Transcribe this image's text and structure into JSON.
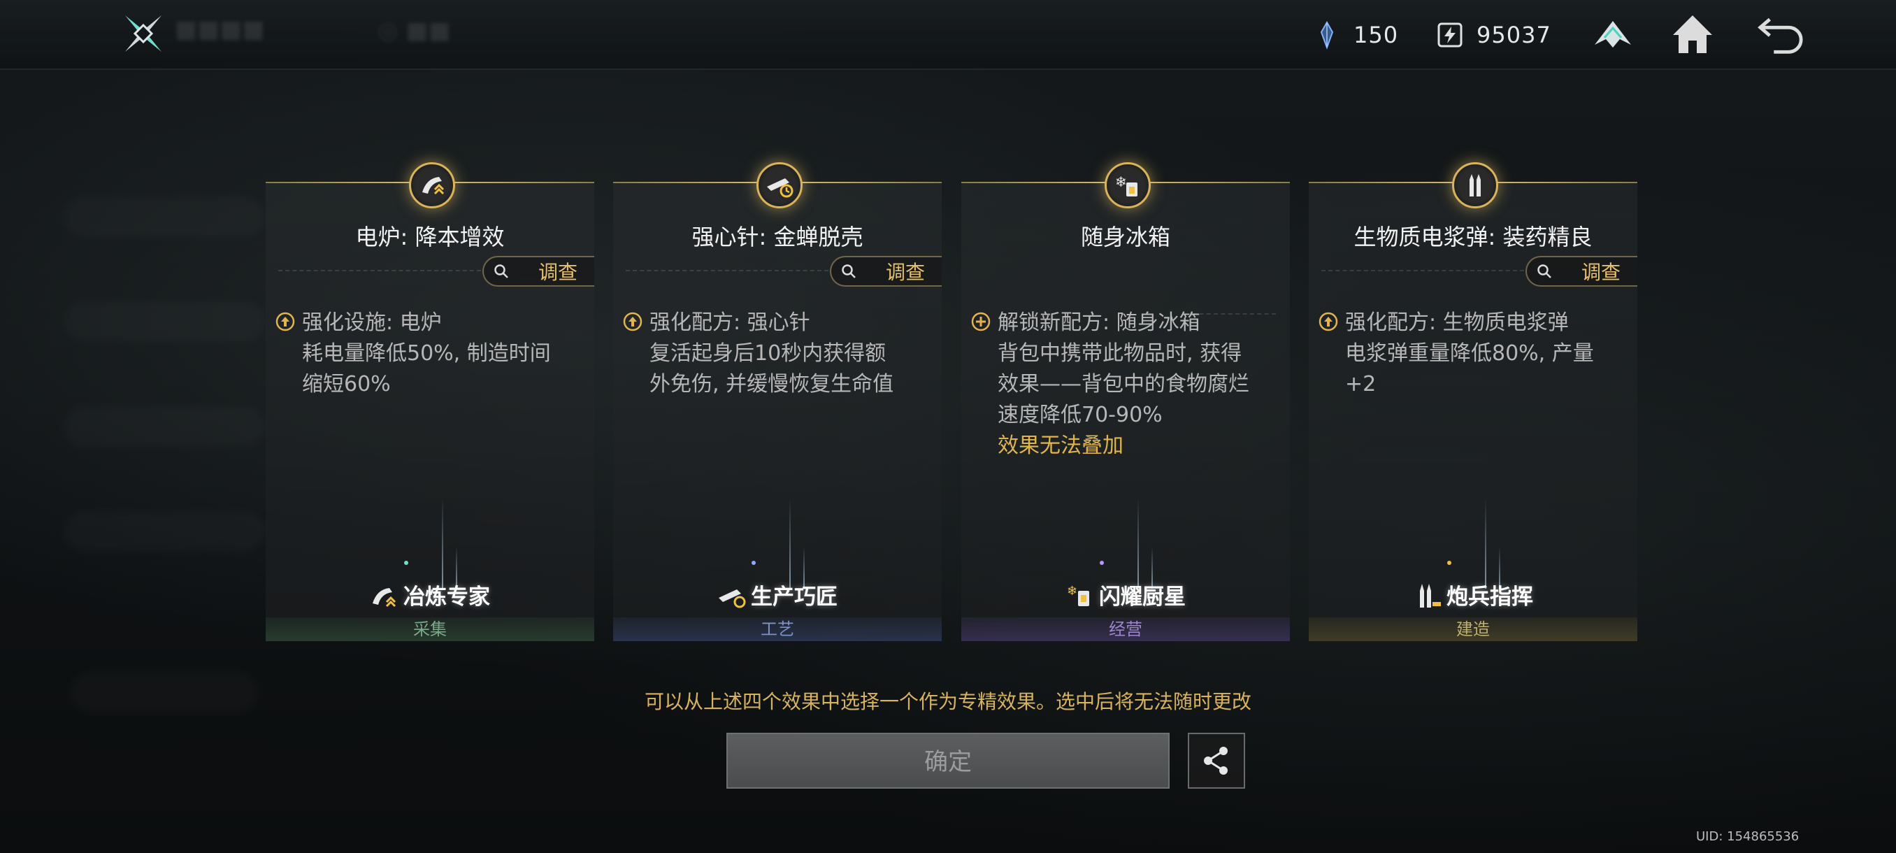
{
  "topbar": {
    "resource_1": {
      "icon": "crystal-shard-icon",
      "value": "150"
    },
    "resource_2": {
      "icon": "energy-cell-icon",
      "value": "95037"
    }
  },
  "cards": [
    {
      "title": "电炉: 降本增效",
      "investigate": "调查",
      "effect_label": "强化设施: 电炉",
      "effect_lines": [
        "耗电量降低50%, 制造时间",
        "缩短60%"
      ],
      "specialization": "冶炼专家",
      "category": "采集"
    },
    {
      "title": "强心针: 金蝉脱壳",
      "investigate": "调查",
      "effect_label": "强化配方: 强心针",
      "effect_lines": [
        "复活起身后10秒内获得额",
        "外免伤, 并缓慢恢复生命值"
      ],
      "specialization": "生产巧匠",
      "category": "工艺"
    },
    {
      "title": "随身冰箱",
      "effect_label": "解锁新配方: 随身冰箱",
      "effect_lines": [
        "背包中携带此物品时, 获得",
        "效果——背包中的食物腐烂",
        "速度降低70-90%"
      ],
      "warning": "效果无法叠加",
      "specialization": "闪耀厨星",
      "category": "经营"
    },
    {
      "title": "生物质电浆弹: 装药精良",
      "investigate": "调查",
      "effect_label": "强化配方: 生物质电浆弹",
      "effect_lines": [
        "电浆弹重量降低80%, 产量",
        "+2"
      ],
      "specialization": "炮兵指挥",
      "category": "建造"
    }
  ],
  "hint": "可以从上述四个效果中选择一个作为专精效果。选中后将无法随时更改",
  "confirm_label": "确定",
  "uid": "UID: 154865536"
}
